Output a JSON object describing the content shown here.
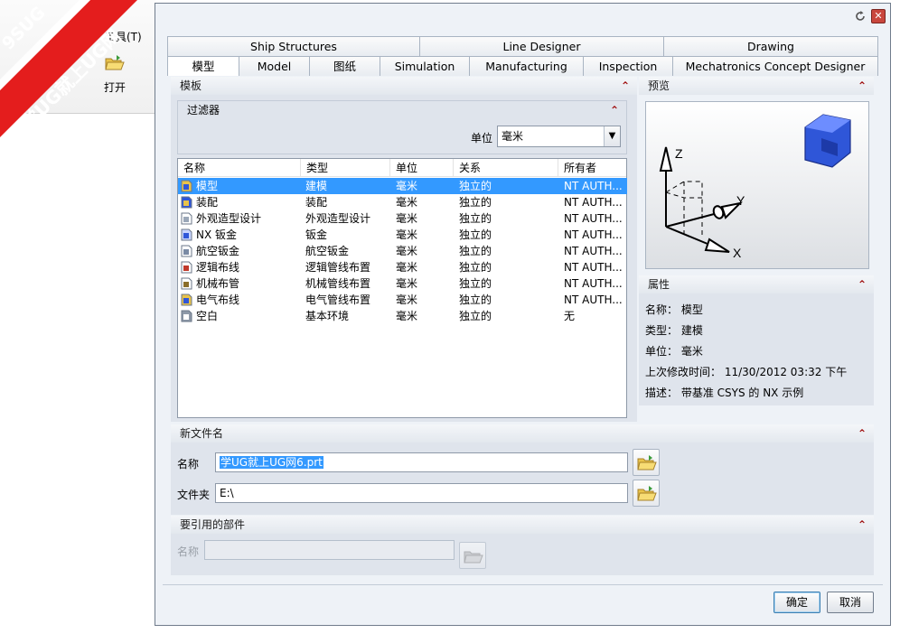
{
  "watermark": {
    "line1": "9SUG",
    "line2": "学UG就上UG网"
  },
  "background_app": {
    "menu_tools": "工具(T)",
    "open_label": "打开"
  },
  "dialog": {
    "tabs_main": [
      "Ship Structures",
      "Line Designer",
      "Drawing"
    ],
    "tabs_sub": [
      "模型",
      "Model",
      "图纸",
      "Simulation",
      "Manufacturing",
      "Inspection",
      "Mechatronics Concept Designer"
    ],
    "active_tab": "模型",
    "templates": {
      "header": "模板",
      "filter_header": "过滤器",
      "unit_label": "单位",
      "unit_value": "毫米",
      "columns": [
        "名称",
        "类型",
        "单位",
        "关系",
        "所有者"
      ],
      "rows": [
        {
          "icon": "model-icon",
          "name": "模型",
          "type": "建模",
          "unit": "毫米",
          "relation": "独立的",
          "owner": "NT AUTH...",
          "selected": true
        },
        {
          "icon": "assembly-icon",
          "name": "装配",
          "type": "装配",
          "unit": "毫米",
          "relation": "独立的",
          "owner": "NT AUTH...",
          "selected": false
        },
        {
          "icon": "shape-studio-icon",
          "name": "外观造型设计",
          "type": "外观造型设计",
          "unit": "毫米",
          "relation": "独立的",
          "owner": "NT AUTH...",
          "selected": false
        },
        {
          "icon": "sheet-metal-icon",
          "name": "NX 钣金",
          "type": "钣金",
          "unit": "毫米",
          "relation": "独立的",
          "owner": "NT AUTH...",
          "selected": false
        },
        {
          "icon": "aero-sheet-metal-icon",
          "name": "航空钣金",
          "type": "航空钣金",
          "unit": "毫米",
          "relation": "独立的",
          "owner": "NT AUTH...",
          "selected": false
        },
        {
          "icon": "logical-routing-icon",
          "name": "逻辑布线",
          "type": "逻辑管线布置",
          "unit": "毫米",
          "relation": "独立的",
          "owner": "NT AUTH...",
          "selected": false
        },
        {
          "icon": "mechanical-routing-icon",
          "name": "机械布管",
          "type": "机械管线布置",
          "unit": "毫米",
          "relation": "独立的",
          "owner": "NT AUTH...",
          "selected": false
        },
        {
          "icon": "electrical-routing-icon",
          "name": "电气布线",
          "type": "电气管线布置",
          "unit": "毫米",
          "relation": "独立的",
          "owner": "NT AUTH...",
          "selected": false
        },
        {
          "icon": "blank-icon",
          "name": "空白",
          "type": "基本环境",
          "unit": "毫米",
          "relation": "独立的",
          "owner": "无",
          "selected": false
        }
      ]
    },
    "preview": {
      "header": "预览",
      "axis_x": "X",
      "axis_y": "Y",
      "axis_z": "Z"
    },
    "properties": {
      "header": "属性",
      "name": "名称： 模型",
      "type": "类型： 建模",
      "unit": "单位： 毫米",
      "modified": "上次修改时间： 11/30/2012 03:32 下午",
      "description": "描述： 带基准 CSYS 的 NX 示例"
    },
    "new_file": {
      "header": "新文件名",
      "name_label": "名称",
      "name_value": "学UG就上UG网6.prt",
      "folder_label": "文件夹",
      "folder_value": "E:\\"
    },
    "referenced_part": {
      "header": "要引用的部件",
      "name_label": "名称",
      "name_value": ""
    },
    "ok_label": "确定",
    "cancel_label": "取消"
  },
  "colors": {
    "selection": "#3399ff",
    "chevron": "#a01010",
    "dialog_bg": "#eef2f7",
    "panel_bg": "#dfe4ec"
  }
}
